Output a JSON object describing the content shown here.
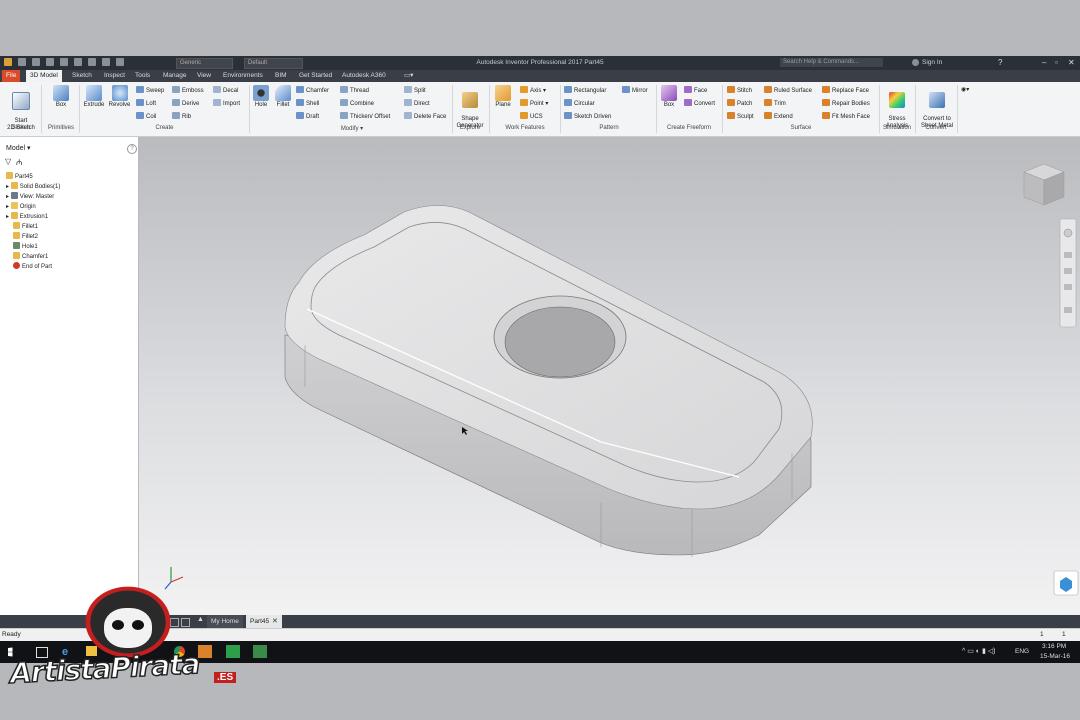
{
  "app": {
    "title": "Autodesk Inventor Professional 2017   Part45",
    "material_combo": "Generic",
    "appearance_combo": "Default",
    "search_placeholder": "Search Help & Commands...",
    "sign_in": "Sign In"
  },
  "menu_tabs": [
    "File",
    "3D Model",
    "Sketch",
    "Inspect",
    "Tools",
    "Manage",
    "View",
    "Environments",
    "BIM",
    "Get Started",
    "Autodesk A360"
  ],
  "ribbon": {
    "sketch": {
      "start_2d_sketch": "Start\n2D Sketch",
      "group": "Sketch"
    },
    "primitives": {
      "box": "Box",
      "group": "Primitives"
    },
    "create": {
      "extrude": "Extrude",
      "revolve": "Revolve",
      "sweep": "Sweep",
      "loft": "Loft",
      "coil": "Coil",
      "emboss": "Emboss",
      "derive": "Derive",
      "rib": "Rib",
      "decal": "Decal",
      "import": "Import",
      "group": "Create"
    },
    "modify": {
      "hole": "Hole",
      "fillet": "Fillet",
      "chamfer": "Chamfer",
      "shell": "Shell",
      "draft": "Draft",
      "thread": "Thread",
      "combine": "Combine",
      "thicken_offset": "Thicken/ Offset",
      "split": "Split",
      "direct": "Direct",
      "delete_face": "Delete Face",
      "group": "Modify ▾"
    },
    "explore": {
      "shape_generator": "Shape\nGenerator",
      "group": "Explore"
    },
    "work_features": {
      "plane": "Plane",
      "axis": "Axis ▾",
      "point": "Point ▾",
      "ucs": "UCS",
      "group": "Work Features"
    },
    "pattern": {
      "rectangular": "Rectangular",
      "circular": "Circular",
      "sketch_driven": "Sketch Driven",
      "mirror": "Mirror",
      "group": "Pattern"
    },
    "create_freeform": {
      "box": "Box",
      "face": "Face",
      "convert": "Convert",
      "group": "Create Freeform"
    },
    "surface": {
      "stitch": "Stitch",
      "patch": "Patch",
      "sculpt": "Sculpt",
      "ruled_surface": "Ruled Surface",
      "trim": "Trim",
      "extend": "Extend",
      "replace_face": "Replace Face",
      "repair_bodies": "Repair Bodies",
      "fit_mesh_face": "Fit Mesh Face",
      "group": "Surface"
    },
    "simulation": {
      "stress_analysis": "Stress\nAnalysis",
      "group": "Simulation"
    },
    "convert": {
      "convert_to_sheet_metal": "Convert to\nSheet Metal",
      "group": "Convert"
    }
  },
  "browser": {
    "title": "Model ▾",
    "help": "?",
    "items": [
      {
        "label": "Part45",
        "color": "#e8b84a"
      },
      {
        "label": "Solid Bodies(1)",
        "color": "#e8b84a"
      },
      {
        "label": "View: Master",
        "color": "#6c7a8a"
      },
      {
        "label": "Origin",
        "color": "#e8c65a"
      },
      {
        "label": "Extrusion1",
        "color": "#e8b84a"
      },
      {
        "label": "Fillet1",
        "color": "#e8b84a"
      },
      {
        "label": "Fillet2",
        "color": "#e8b84a"
      },
      {
        "label": "Hole1",
        "color": "#6c8a6a"
      },
      {
        "label": "Chamfer1",
        "color": "#e8b84a"
      },
      {
        "label": "End of Part",
        "color": "#d0392b"
      }
    ]
  },
  "doc_tabs": [
    "My Home",
    "Part45"
  ],
  "status": {
    "text": "Ready",
    "num1": "1",
    "num2": "1"
  },
  "taskbar": {
    "lang": "ENG",
    "time": "3:16 PM",
    "date": "15-Mar-16"
  },
  "watermark": {
    "text": "ArtistaPirata",
    "suffix": ".ES"
  }
}
